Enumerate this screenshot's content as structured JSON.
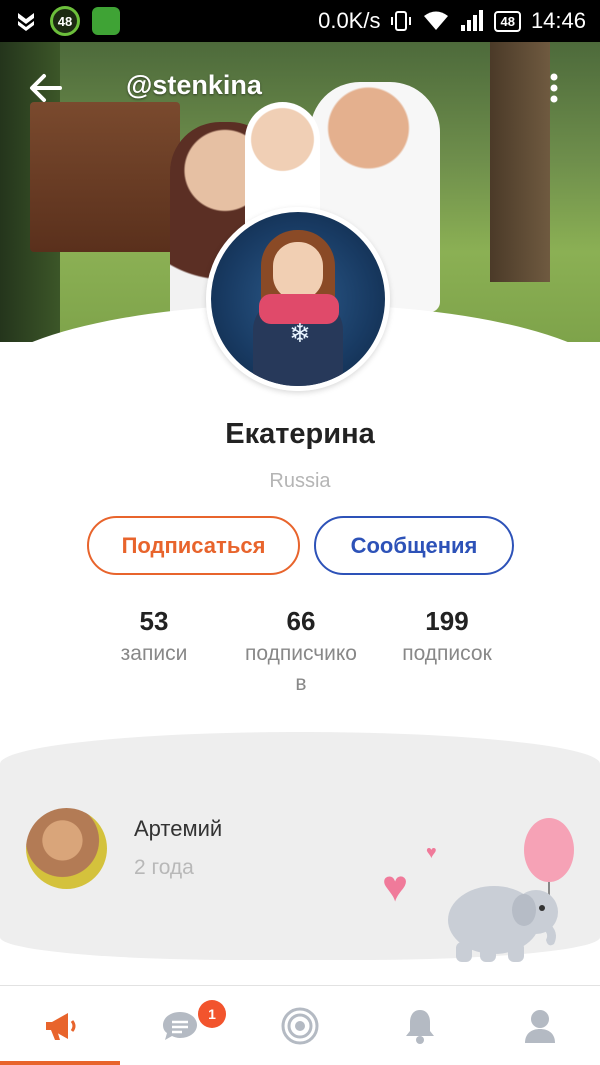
{
  "status_bar": {
    "badge_left": "48",
    "net_speed": "0.0K/s",
    "battery": "48",
    "time": "14:46",
    "icons": [
      "shield-icon",
      "app-badge-icon",
      "lion-shield-icon",
      "vibrate-icon",
      "wifi-icon",
      "signal-icon",
      "battery-icon"
    ]
  },
  "header": {
    "handle": "@stenkina",
    "back_icon": "arrow-left-icon",
    "more_icon": "more-vertical-icon"
  },
  "profile": {
    "name": "Екатерина",
    "country": "Russia",
    "subscribe_label": "Подписаться",
    "messages_label": "Сообщения"
  },
  "stats": [
    {
      "value": "53",
      "label": "записи"
    },
    {
      "value": "66",
      "label": "подписчико\nв"
    },
    {
      "value": "199",
      "label": "подписок"
    }
  ],
  "family": {
    "child_name": "Артемий",
    "child_age": "2 года"
  },
  "bottom_nav": {
    "items": [
      "megaphone-icon",
      "chat-icon",
      "target-icon",
      "bell-icon",
      "profile-icon"
    ],
    "chat_badge": "1"
  },
  "colors": {
    "accent_orange": "#e8642c",
    "accent_blue": "#2d52b8",
    "badge_red": "#f2542d"
  }
}
